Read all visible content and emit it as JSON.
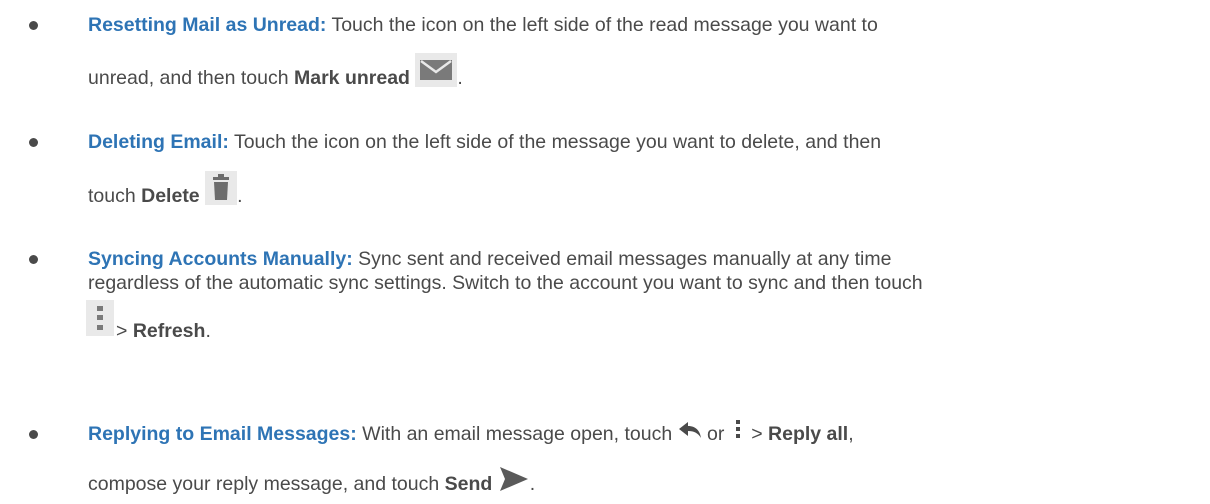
{
  "items": [
    {
      "term": "Resetting Mail as Unread:",
      "line1": " Touch the icon on the left side of the read message you want to",
      "line2_pre": "unread, and then touch ",
      "cmd": "Mark unread",
      "icon": "mark-unread-envelope-icon",
      "after": "."
    },
    {
      "term": "Deleting Email:",
      "line1": " Touch the icon on the left side of the message you want to delete, and then",
      "line2_pre": "touch ",
      "cmd": "Delete",
      "icon": "trash-icon",
      "after": "."
    },
    {
      "term": "Syncing Accounts Manually:",
      "line1": " Sync sent and received email messages manually at any time",
      "line2": "regardless of the automatic sync settings. Switch to the account you want to sync and then touch",
      "icon": "more-options-icon",
      "line3_pre": " > ",
      "cmd": "Refresh",
      "after": "."
    },
    {
      "term": "Replying to Email Messages:",
      "line1": " With an email message open, touch ",
      "icon_reply": "reply-icon",
      "or": " or ",
      "icon_more": "more-options-icon",
      "sep": " > ",
      "cmd1": "Reply all",
      "comma": ",",
      "line2_pre": "compose your reply message, and touch ",
      "cmd2": "Send",
      "icon_send": "send-icon",
      "after": "."
    }
  ],
  "colors": {
    "term": "#2e74b5",
    "text": "#4a4a4a",
    "icon_bg": "#e9e9e9",
    "icon_fg": "#6d6d6d"
  }
}
